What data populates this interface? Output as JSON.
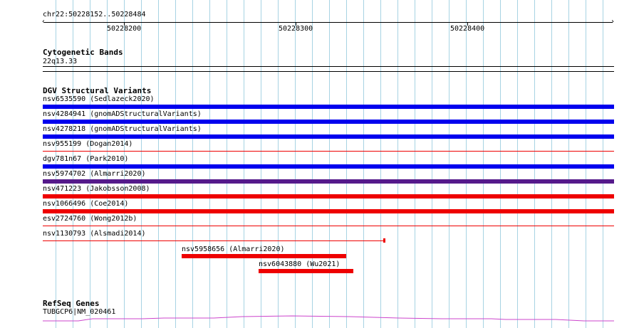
{
  "ruler": {
    "region_label": "chr22:50228152..50228484",
    "ticks": [
      "50228200",
      "50228300",
      "50228400"
    ]
  },
  "cytoband_track": {
    "title": "Cytogenetic Bands",
    "band_label": "22q13.33"
  },
  "dgv_track": {
    "title": "DGV Structural Variants",
    "features": [
      {
        "label": "nsv6535590 (Sedlazeck2020)",
        "color": "#0000ee",
        "style": "thick"
      },
      {
        "label": "nsv4284941 (gnomADStructuralVariants)",
        "color": "#0000ee",
        "style": "thick"
      },
      {
        "label": "nsv4278218 (gnomADStructuralVariants)",
        "color": "#0000ee",
        "style": "thick"
      },
      {
        "label": "nsv955199 (Dogan2014)",
        "color": "#ee0000",
        "style": "thin"
      },
      {
        "label": "dgv781n67 (Park2010)",
        "color": "#0000ee",
        "style": "thick"
      },
      {
        "label": "nsv5974702 (Almarri2020)",
        "color": "#551a8b",
        "style": "thick"
      },
      {
        "label": "nsv471223 (Jakobsson2008)",
        "color": "#ee0000",
        "style": "thick"
      },
      {
        "label": "nsv1066496 (Coe2014)",
        "color": "#ee0000",
        "style": "thick"
      },
      {
        "label": "esv2724760 (Wong2012b)",
        "color": "#ee0000",
        "style": "thin"
      },
      {
        "label": "nsv1130793 (Alsmadi2014)",
        "color": "#ee0000",
        "style": "thin-end"
      },
      {
        "label": "nsv5958656 (Almarri2020)",
        "color": "#ee0000",
        "style": "thick-short"
      },
      {
        "label": "nsv6043880 (Wu2021)",
        "color": "#ee0000",
        "style": "thick-short"
      }
    ]
  },
  "refseq_track": {
    "title": "RefSeq Genes",
    "gene_label": "TUBGCP6|NM_020461",
    "color": "#cc44cc"
  }
}
